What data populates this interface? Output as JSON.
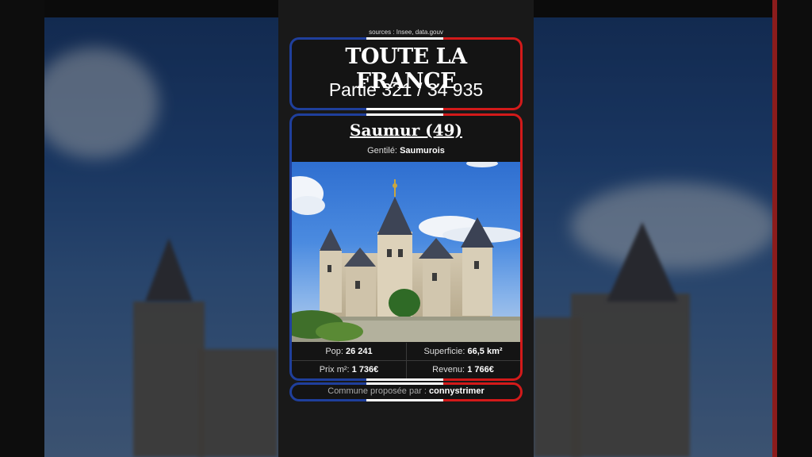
{
  "sources": "sources : Insee, data.gouv",
  "header": {
    "title": "TOUTE LA FRANCE",
    "subtitle": "Partie 321 / 34 935"
  },
  "commune": {
    "name": "Saumur (49)",
    "gentile_label": "Gentilé:",
    "gentile_value": "Saumurois",
    "image_icon": "castle-photo"
  },
  "stats": {
    "pop_label": "Pop:",
    "pop_value": "26 241",
    "superficie_label": "Superficie:",
    "superficie_value": "66,5 km²",
    "prix_label": "Prix m²:",
    "prix_value": "1 736€",
    "revenu_label": "Revenu:",
    "revenu_value": "1 766€"
  },
  "footer": {
    "label": "Commune proposée par :",
    "author": "connystrimer"
  },
  "colors": {
    "flag_blue": "#1f3f9c",
    "flag_white": "#ffffff",
    "flag_red": "#d31a1a",
    "card_bg": "#141414"
  }
}
